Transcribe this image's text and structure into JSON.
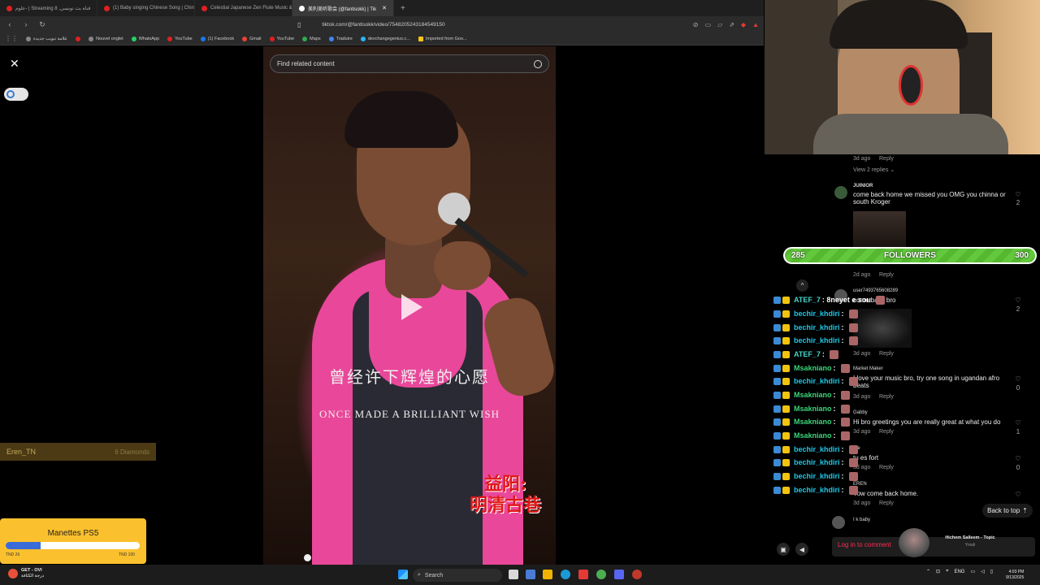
{
  "browser": {
    "tabs": [
      {
        "title": "علوم- | Streaming 8 ,قناة بث تونسي",
        "active": false
      },
      {
        "title": "(1) Baby singing Chinese Song | Chin",
        "active": false
      },
      {
        "title": "Celestial Japanese Zen Flute Music &",
        "active": false
      },
      {
        "title": "美利美听歌会 (@fantisokk) | Tik",
        "active": true
      }
    ],
    "new_tab": "+",
    "url": "tiktok.com/@fantisokk/video/7548205243184549150",
    "bookmarks": [
      {
        "label": "علامة تبويب جديدة",
        "icon": "chrome-icon"
      },
      {
        "label": "",
        "icon": "youtube-icon"
      },
      {
        "label": "Nouvel onglet",
        "icon": "chrome-icon"
      },
      {
        "label": "WhatsApp",
        "icon": "whatsapp-icon"
      },
      {
        "label": "YouTube",
        "icon": "youtube-icon"
      },
      {
        "label": "(1) Facebook",
        "icon": "facebook-icon"
      },
      {
        "label": "Gmail",
        "icon": "gmail-icon"
      },
      {
        "label": "YouTube",
        "icon": "youtube-icon"
      },
      {
        "label": "Maps",
        "icon": "maps-icon"
      },
      {
        "label": "Traduire",
        "icon": "translate-icon"
      },
      {
        "label": "dexchangegenius.c...",
        "icon": "link-icon"
      },
      {
        "label": "Imported from Goo...",
        "icon": "folder-icon"
      }
    ]
  },
  "tiktok": {
    "search_placeholder": "Find related content",
    "subtitle_cn": "曾经许下辉煌的心愿",
    "subtitle_en": "ONCE MADE A BRILLIANT WISH",
    "logo_line1": "益阳:",
    "logo_line2": "明清古巷",
    "comments": [
      {
        "meta_time": "3d ago",
        "reply": "Reply",
        "view_replies": "View 2 replies"
      },
      {
        "name": "JUINIOR",
        "text": "come back home we missed you OMG you chinna or south Kroger",
        "time": "2d ago",
        "reply": "Reply",
        "likes": "2"
      },
      {
        "name": "user7493765608289",
        "text": "come back bro",
        "time": "3d ago",
        "reply": "Reply",
        "likes": "2"
      },
      {
        "name": "Market Maker",
        "text": "I love your music bro, try one song in ugandan afro beats",
        "time": "3d ago",
        "reply": "Reply",
        "likes": "0"
      },
      {
        "name": "Gabby",
        "text": "Hi bro greetings you are really great at what you do",
        "time": "3d ago",
        "reply": "Reply",
        "likes": "1"
      },
      {
        "name": "dre",
        "text": "tu es fort",
        "time": "3d ago",
        "reply": "Reply",
        "likes": "0"
      },
      {
        "name": "EREN",
        "text": "Yow come back home.",
        "time": "3d ago",
        "reply": "Reply",
        "likes": ""
      },
      {
        "name": "I k baby",
        "text": "",
        "time": "",
        "reply": "",
        "likes": ""
      }
    ],
    "back_to_top": "Back to top",
    "login_prompt": "Log in to comment"
  },
  "stream_overlay": {
    "followers": {
      "current": "285",
      "label": "FOLLOWERS",
      "goal": "300"
    },
    "chat": [
      {
        "name": "ATEF_7",
        "text": ": 8neyet e sou",
        "color": "#46d3c8"
      },
      {
        "name": "bechir_khdiri",
        "text": ":",
        "color": "#1fc8e6"
      },
      {
        "name": "bechir_khdiri",
        "text": ":",
        "color": "#1fc8e6"
      },
      {
        "name": "bechir_khdiri",
        "text": ":",
        "color": "#1fc8e6"
      },
      {
        "name": "ATEF_7",
        "text": ":",
        "color": "#46d3c8"
      },
      {
        "name": "Msakniano",
        "text": ":",
        "color": "#3bd57a"
      },
      {
        "name": "bechir_khdiri",
        "text": ":",
        "color": "#1fc8e6"
      },
      {
        "name": "Msakniano",
        "text": ":",
        "color": "#3bd57a"
      },
      {
        "name": "Msakniano",
        "text": ":",
        "color": "#3bd57a"
      },
      {
        "name": "Msakniano",
        "text": ":",
        "color": "#3bd57a"
      },
      {
        "name": "Msakniano",
        "text": ":",
        "color": "#3bd57a"
      },
      {
        "name": "bechir_khdiri",
        "text": ":",
        "color": "#1fc8e6"
      },
      {
        "name": "bechir_khdiri",
        "text": ":",
        "color": "#1fc8e6"
      },
      {
        "name": "bechir_khdiri",
        "text": ":",
        "color": "#1fc8e6"
      },
      {
        "name": "bechir_khdiri",
        "text": ":",
        "color": "#1fc8e6"
      }
    ],
    "gift": {
      "user": "Eren_TN",
      "amount": "6 Diamonds"
    },
    "goal": {
      "title": "Manettes PS5",
      "min": "TND 26",
      "max": "TND 100",
      "progress": 0.26
    },
    "now_playing": {
      "title": "Hichem Salleem - Topic",
      "sub": "Yrouli"
    }
  },
  "taskbar": {
    "weather_title": "GET - OVI",
    "weather_sub": "درجة الكثافة",
    "search": "Search",
    "lang": "ENG",
    "time": "4:03 PM",
    "date": "9/13/2025"
  }
}
